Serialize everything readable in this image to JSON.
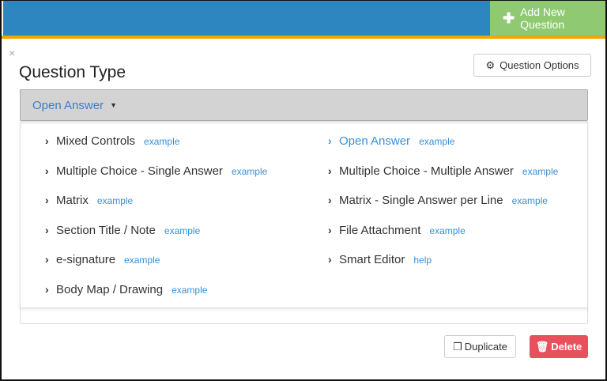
{
  "header": {
    "add_button": "Add New Question",
    "colors": {
      "bar": "#2e86c1",
      "accent": "#f5a300",
      "add": "#8fca72",
      "delete": "#e8505b"
    }
  },
  "dialog": {
    "close": "×",
    "title": "Question Type",
    "options_button": "Question Options",
    "selected": "Open Answer"
  },
  "menu": {
    "items": [
      {
        "label": "Mixed Controls",
        "link": "example"
      },
      {
        "label": "Open Answer",
        "link": "example",
        "active": true
      },
      {
        "label": "Multiple Choice - Single Answer",
        "link": "example"
      },
      {
        "label": "Multiple Choice - Multiple Answer",
        "link": "example"
      },
      {
        "label": "Matrix",
        "link": "example"
      },
      {
        "label": "Matrix - Single Answer per Line",
        "link": "example"
      },
      {
        "label": "Section Title / Note",
        "link": "example"
      },
      {
        "label": "File Attachment",
        "link": "example"
      },
      {
        "label": "e-signature",
        "link": "example"
      },
      {
        "label": "Smart Editor",
        "link": "help"
      },
      {
        "label": "Body Map / Drawing",
        "link": "example"
      }
    ]
  },
  "footer": {
    "duplicate": "Duplicate",
    "delete": "Delete"
  }
}
